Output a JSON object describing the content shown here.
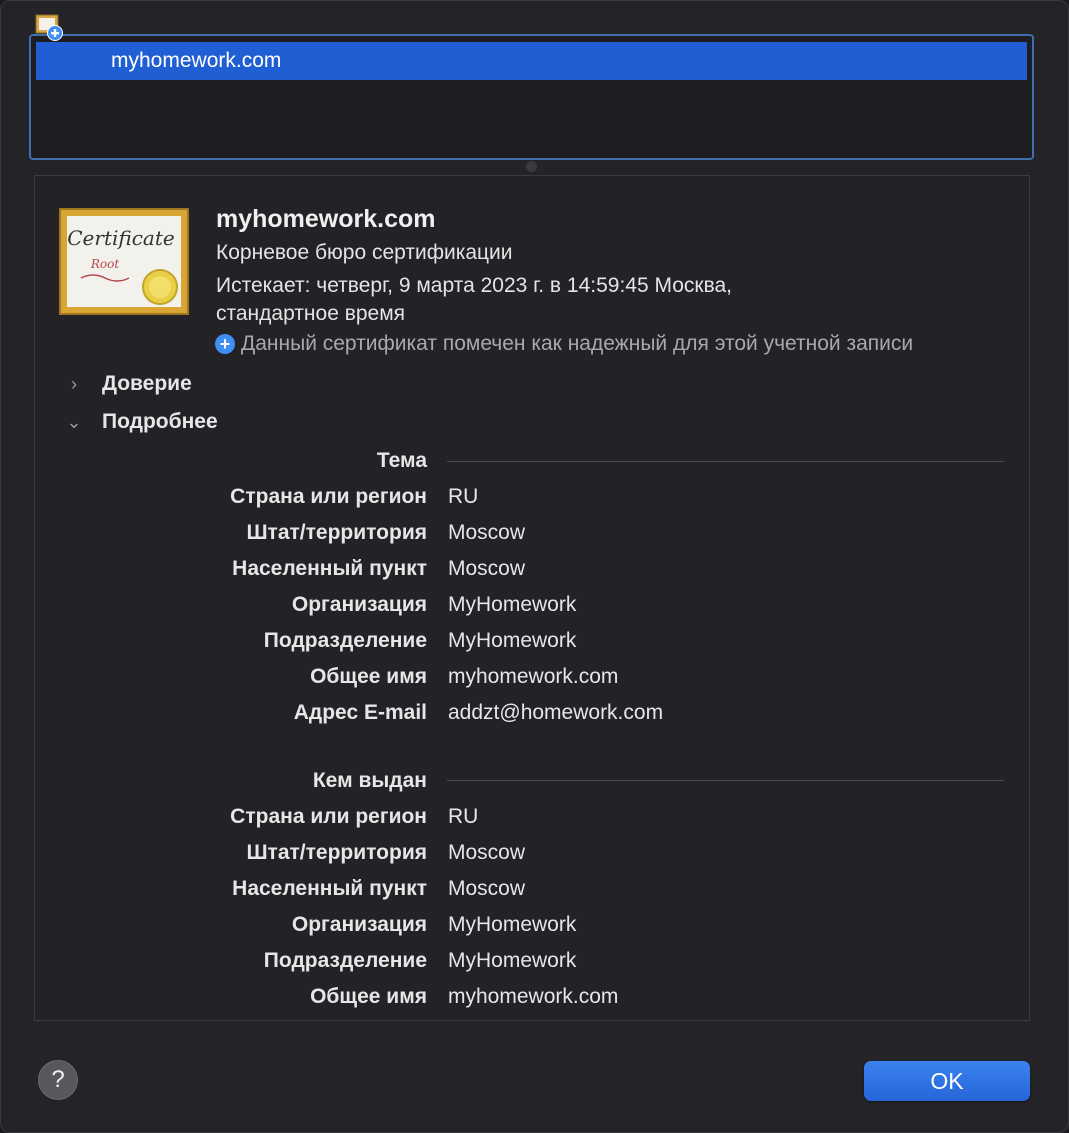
{
  "list": {
    "selected_item": "myhomework.com"
  },
  "certificate": {
    "name": "myhomework.com",
    "kind": "Корневое бюро сертификации",
    "expires": "Истекает: четверг, 9 марта 2023 г. в 14:59:45 Москва, стандартное время",
    "trust_status": "Данный сертификат помечен как надежный для этой учетной записи",
    "icon_text": {
      "title": "Certificate",
      "subtitle": "Root"
    }
  },
  "sections": {
    "trust_label": "Доверие",
    "details_label": "Подробнее"
  },
  "subject": {
    "heading": "Тема",
    "rows": [
      {
        "key": "Страна или регион",
        "value": "RU"
      },
      {
        "key": "Штат/территория",
        "value": "Moscow"
      },
      {
        "key": "Населенный пункт",
        "value": "Moscow"
      },
      {
        "key": "Организация",
        "value": "MyHomework"
      },
      {
        "key": "Подразделение",
        "value": "MyHomework"
      },
      {
        "key": "Общее имя",
        "value": "myhomework.com"
      },
      {
        "key": "Адрес E-mail",
        "value": "addzt@homework.com"
      }
    ]
  },
  "issuer": {
    "heading": "Кем выдан",
    "rows": [
      {
        "key": "Страна или регион",
        "value": "RU"
      },
      {
        "key": "Штат/территория",
        "value": "Moscow"
      },
      {
        "key": "Населенный пункт",
        "value": "Moscow"
      },
      {
        "key": "Организация",
        "value": "MyHomework"
      },
      {
        "key": "Подразделение",
        "value": "MyHomework"
      },
      {
        "key": "Общее имя",
        "value": "myhomework.com"
      }
    ]
  },
  "buttons": {
    "help": "?",
    "ok": "OK"
  },
  "colors": {
    "selection": "#1f5fd3",
    "accent": "#3f8ff5",
    "background": "#242328"
  }
}
